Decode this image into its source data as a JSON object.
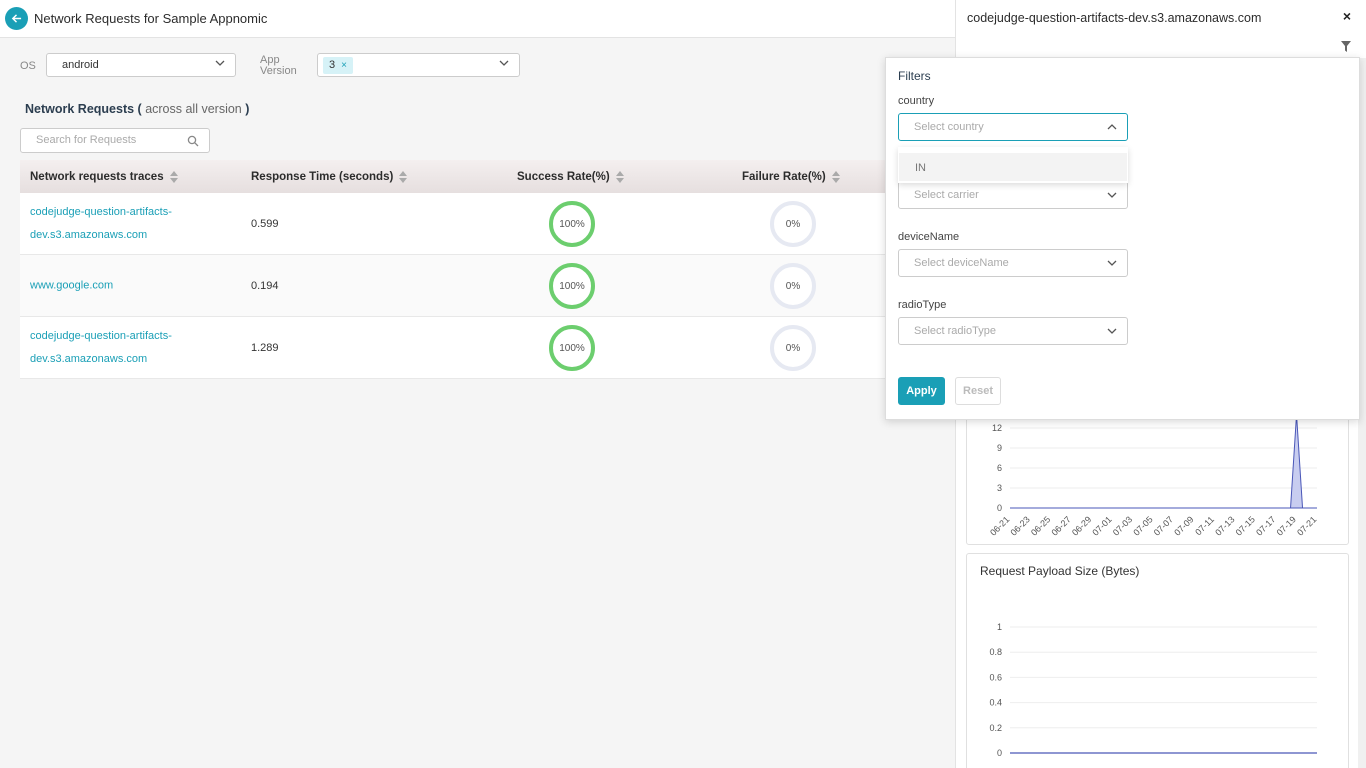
{
  "header": {
    "title": "Network Requests for Sample Appnomic"
  },
  "filters": {
    "os_label": "OS",
    "os_value": "android",
    "app_version_label_line1": "App",
    "app_version_label_line2": "Version",
    "app_version_tag": "3",
    "app_version_tag_remove": "×"
  },
  "section": {
    "title": "Network Requests (",
    "subtitle": "across all version",
    "close": ")"
  },
  "search": {
    "placeholder": "Search for Requests"
  },
  "table": {
    "columns": [
      "Network requests traces",
      "Response Time (seconds)",
      "Success Rate(%)",
      "Failure Rate(%)"
    ],
    "rows": [
      {
        "url_line1": "codejudge-question-artifacts-",
        "url_line2": "dev.s3.amazonaws.com",
        "time": "0.599",
        "success": "100%",
        "failure": "0%"
      },
      {
        "url_line1": "www.google.com",
        "url_line2": "",
        "time": "0.194",
        "success": "100%",
        "failure": "0%"
      },
      {
        "url_line1": "codejudge-question-artifacts-",
        "url_line2": "dev.s3.amazonaws.com",
        "time": "1.289",
        "success": "100%",
        "failure": "0%"
      }
    ]
  },
  "right_panel": {
    "title": "codejudge-question-artifacts-dev.s3.amazonaws.com",
    "close": "×",
    "chart1": {
      "type": "area",
      "y_ticks": [
        "12",
        "9",
        "6",
        "3",
        "0"
      ],
      "x_ticks": [
        "06-21",
        "06-23",
        "06-25",
        "06-27",
        "06-29",
        "07-01",
        "07-03",
        "07-05",
        "07-07",
        "07-09",
        "07-11",
        "07-13",
        "07-15",
        "07-17",
        "07-19",
        "07-21"
      ]
    },
    "chart2": {
      "title": "Request Payload Size (Bytes)",
      "type": "line",
      "y_ticks": [
        "1",
        "0.8",
        "0.6",
        "0.4",
        "0.2",
        "0"
      ]
    }
  },
  "filter_popover": {
    "title": "Filters",
    "country_label": "country",
    "country_placeholder": "Select country",
    "country_option": "IN",
    "carrier_placeholder": "Select carrier",
    "device_label": "deviceName",
    "device_placeholder": "Select deviceName",
    "radio_label": "radioType",
    "radio_placeholder": "Select radioType",
    "apply": "Apply",
    "reset": "Reset"
  },
  "colors": {
    "accent": "#1a9fb6",
    "success": "#6cce6e",
    "failure_ring": "#e6e9f2"
  },
  "chart_data": [
    {
      "type": "area",
      "title": "",
      "x": [
        "06-21",
        "06-23",
        "06-25",
        "06-27",
        "06-29",
        "07-01",
        "07-03",
        "07-05",
        "07-07",
        "07-09",
        "07-11",
        "07-13",
        "07-15",
        "07-17",
        "07-19",
        "07-21"
      ],
      "values": [
        0,
        0,
        0,
        0,
        0,
        0,
        0,
        0,
        0,
        0,
        0,
        0,
        0,
        0,
        14,
        0
      ],
      "ylim": [
        0,
        15
      ]
    },
    {
      "type": "line",
      "title": "Request Payload Size (Bytes)",
      "values": [
        0,
        0,
        0,
        0,
        0,
        0,
        0,
        0,
        0,
        0,
        0,
        0,
        0,
        0,
        0,
        0
      ],
      "ylim": [
        0,
        1
      ]
    }
  ]
}
